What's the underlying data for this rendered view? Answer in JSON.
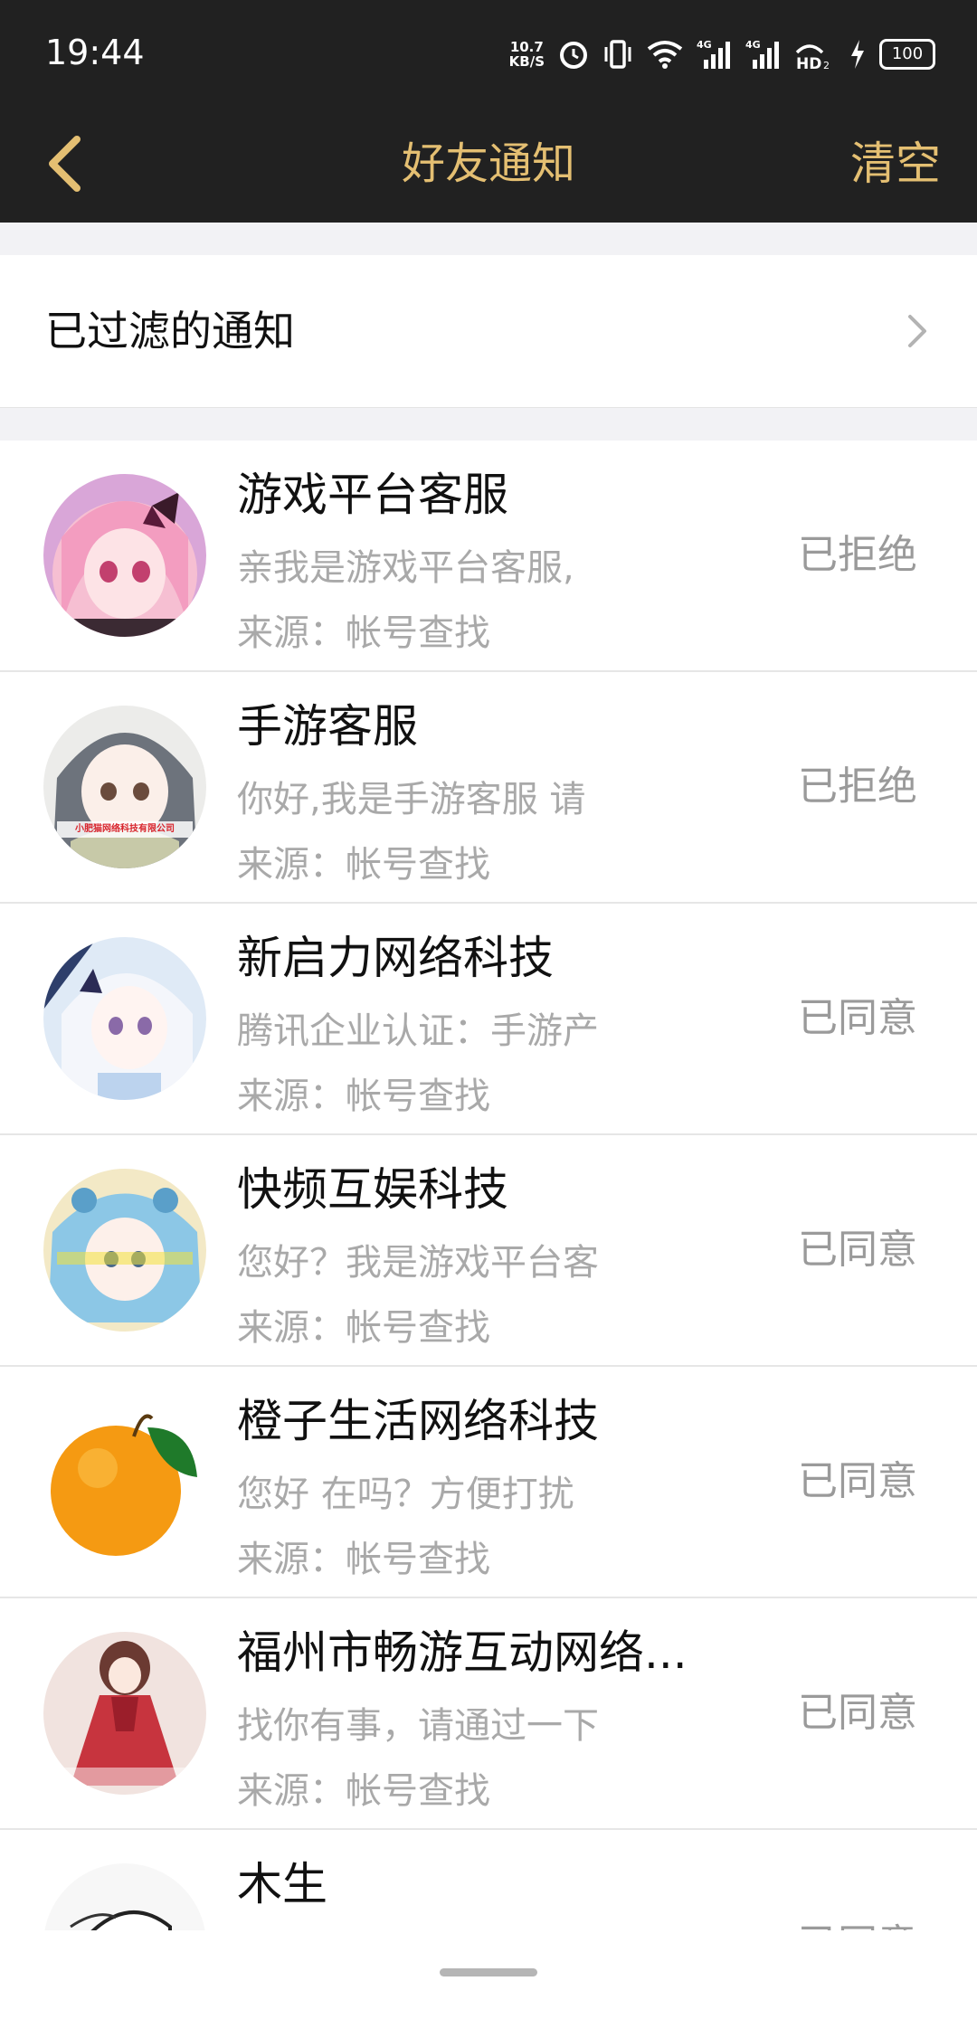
{
  "status_bar": {
    "time": "19:44",
    "net_speed_value": "10.7",
    "net_speed_unit": "KB/S",
    "icons": [
      "alarm-icon",
      "vibrate-icon",
      "wifi-icon",
      "signal-4g-icon",
      "signal-4g-icon",
      "hd-icon",
      "charging-icon"
    ],
    "battery": "100"
  },
  "header": {
    "title": "好友通知",
    "clear_label": "清空",
    "accent_color": "#e4bf72"
  },
  "filtered": {
    "label": "已过滤的通知"
  },
  "notifications": [
    {
      "name": "游戏平台客服",
      "message": "亲我是游戏平台客服,",
      "source": "来源：帐号查找",
      "status": "已拒绝",
      "avatar": "anime-girl-pink"
    },
    {
      "name": "手游客服",
      "message": "你好,我是手游客服 请",
      "source": "来源：帐号查找",
      "status": "已拒绝",
      "avatar": "anime-girl-grey",
      "avatar_caption": "小肥猫网络科技有限公司"
    },
    {
      "name": "新启力网络科技",
      "message": "腾讯企业认证：手游产",
      "source": "来源：帐号查找",
      "status": "已同意",
      "avatar": "anime-girl-white"
    },
    {
      "name": "快频互娱科技",
      "message": "您好？我是游戏平台客",
      "source": "来源：帐号查找",
      "status": "已同意",
      "avatar": "anime-girl-blue"
    },
    {
      "name": "橙子生活网络科技",
      "message": "您好 在吗？方便打扰",
      "source": "来源：帐号查找",
      "status": "已同意",
      "avatar": "orange-fruit"
    },
    {
      "name": "福州市畅游互动网络...",
      "message": "找你有事，请通过一下",
      "source": "来源：帐号查找",
      "status": "已同意",
      "avatar": "anime-girl-red-dress"
    },
    {
      "name": "木生",
      "message": "",
      "source": "",
      "status": "已同意",
      "avatar": "sketch-face"
    }
  ]
}
